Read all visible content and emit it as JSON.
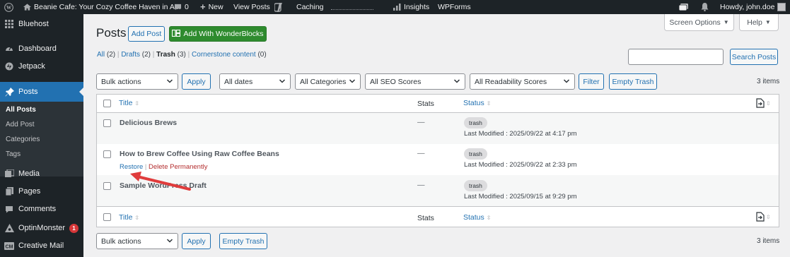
{
  "adminbar": {
    "site_name": "Beanie Cafe: Your Cozy Coffee Haven in A...",
    "comments_count": "0",
    "new_label": "New",
    "view_posts_label": "View Posts",
    "caching_label": "Caching",
    "insights_label": "Insights",
    "wpforms_label": "WPForms",
    "howdy_label": "Howdy, john.doe"
  },
  "sidebar": {
    "items": [
      {
        "label": "Bluehost",
        "icon": "grid-icon"
      },
      {
        "label": "Dashboard",
        "icon": "dashboard-icon"
      },
      {
        "label": "Jetpack",
        "icon": "jetpack-icon"
      },
      {
        "label": "Posts",
        "icon": "pin-icon"
      },
      {
        "label": "Media",
        "icon": "media-icon"
      },
      {
        "label": "Pages",
        "icon": "pages-icon"
      },
      {
        "label": "Comments",
        "icon": "comments-icon"
      },
      {
        "label": "OptinMonster",
        "icon": "optinmonster-icon",
        "badge": "1"
      },
      {
        "label": "Creative Mail",
        "icon": "creative-mail-icon"
      }
    ],
    "submenu": [
      "All Posts",
      "Add Post",
      "Categories",
      "Tags"
    ]
  },
  "header": {
    "title": "Posts",
    "add_post_label": "Add Post",
    "wonderblocks_label": "Add With WonderBlocks",
    "screen_options_label": "Screen Options",
    "help_label": "Help"
  },
  "views": {
    "all": "All",
    "all_count": "(2)",
    "drafts": "Drafts",
    "drafts_count": "(2)",
    "trash": "Trash",
    "trash_count": "(3)",
    "cornerstone": "Cornerstone content",
    "cornerstone_count": "(0)",
    "sep": "|"
  },
  "search": {
    "placeholder": "",
    "button_label": "Search Posts"
  },
  "filters": {
    "bulk_actions": "Bulk actions",
    "apply": "Apply",
    "dates": "All dates",
    "categories": "All Categories",
    "seo": "All SEO Scores",
    "readability": "All Readability Scores",
    "filter": "Filter",
    "empty_trash": "Empty Trash",
    "items_count": "3 items"
  },
  "table": {
    "col_title": "Title",
    "col_stats": "Stats",
    "col_status": "Status",
    "rows": [
      {
        "title": "Delicious Brews",
        "stats": "—",
        "status": "trash",
        "modified": "Last Modified : 2025/09/22 at 4:17 pm"
      },
      {
        "title": "How to Brew Coffee Using Raw Coffee Beans",
        "stats": "—",
        "status": "trash",
        "modified": "Last Modified : 2025/09/22 at 2:33 pm",
        "restore": "Restore",
        "delete": "Delete Permanently"
      },
      {
        "title": "Sample WordPress Draft",
        "stats": "—",
        "status": "trash",
        "modified": "Last Modified : 2025/09/15 at 9:29 pm"
      }
    ]
  },
  "colors": {
    "accent": "#2271b1",
    "adminbar": "#1d2327",
    "delete": "#b32d2e",
    "annotation_arrow": "#e03c3c"
  }
}
